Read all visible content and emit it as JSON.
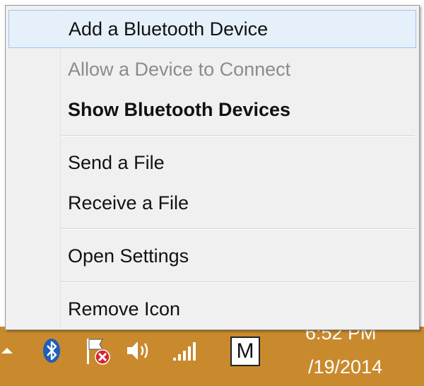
{
  "menu": {
    "items": [
      {
        "label": "Add a Bluetooth Device",
        "state": "highlighted"
      },
      {
        "label": "Allow a Device to Connect",
        "state": "disabled"
      },
      {
        "label": "Show Bluetooth Devices",
        "state": "default-bold"
      },
      {
        "label": "Send a File",
        "state": "normal"
      },
      {
        "label": "Receive a File",
        "state": "normal"
      },
      {
        "label": "Open Settings",
        "state": "normal"
      },
      {
        "label": "Remove Icon",
        "state": "normal"
      }
    ]
  },
  "tray": {
    "icons": [
      "show-hidden-icons-icon",
      "bluetooth-icon",
      "action-center-flag-icon",
      "volume-icon",
      "network-signal-icon",
      "input-method-icon"
    ],
    "ime_letter": "M",
    "clock_time": "6:52 PM",
    "clock_date": "/19/2014"
  },
  "colors": {
    "taskbar": "#c98a2e",
    "highlight_bg": "#e5f0fb",
    "highlight_border": "#9ec6ee",
    "bluetooth_badge": "#1f5fb8",
    "error_badge": "#d8262d"
  }
}
